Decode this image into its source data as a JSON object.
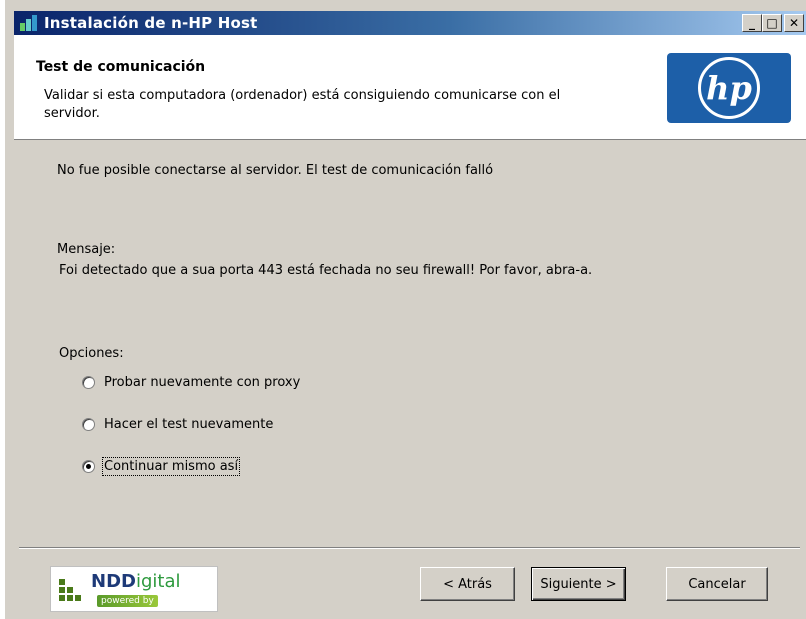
{
  "window": {
    "title": "Instalación de n-HP Host",
    "controls": {
      "minimize": "_",
      "maximize": "□",
      "close": "✕"
    }
  },
  "header": {
    "title": "Test de comunicación",
    "subtitle": "Validar si esta computadora (ordenador) está consiguiendo comunicarse con el servidor.",
    "logo_text": "hp"
  },
  "body": {
    "status_message": "No fue posible conectarse al servidor. El test de comunicación falló",
    "message_label": "Mensaje:",
    "message_text": "Foi detectado que a sua porta 443 está fechada no seu firewall! Por favor, abra-a.",
    "options_label": "Opciones:",
    "options": [
      {
        "label": "Probar nuevamente con proxy",
        "selected": false
      },
      {
        "label": "Hacer el test nuevamente",
        "selected": false
      },
      {
        "label": "Continuar mismo así",
        "selected": true
      }
    ]
  },
  "footer": {
    "brand_name_bold": "NDD",
    "brand_name_light": "igital",
    "brand_tagline": "powered by",
    "back_button": "< Atrás",
    "next_button": "Siguiente >",
    "cancel_button": "Cancelar"
  },
  "colors": {
    "titlebar_start": "#0a246a",
    "dialog_bg": "#d4d0c8",
    "hp_blue": "#1d5fa8"
  }
}
